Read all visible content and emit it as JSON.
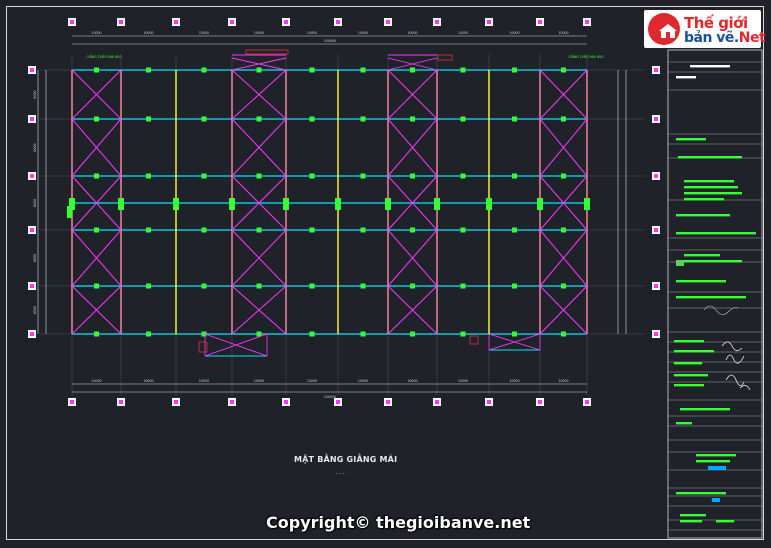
{
  "drawing": {
    "title": "MẶT BẰNG GIẰNG MÁI",
    "scale_note": "- - -",
    "bay_dims_top": [
      "10000",
      "10000",
      "10000",
      "10000",
      "10000",
      "10000",
      "10000",
      "10000",
      "10000",
      "10000"
    ],
    "overall_dim": "100000",
    "left_dims": [
      "6000",
      "6000",
      "6000",
      "6000",
      "6000"
    ],
    "total_left": "36000",
    "note_left": "GIẰNG CHÉO MÁI Φ20",
    "note_right": "GIẰNG CHÉO MÁI Φ20",
    "colors": {
      "background": "#1f2329",
      "rafter": "#ffff33",
      "purlin": "#00e5ff",
      "bracing": "#ff33ff",
      "strut": "#33ff33",
      "dimension": "#d8d8d8",
      "marker": "#ff33ff"
    }
  },
  "logo": {
    "line1": "Thế giới",
    "line2": "bản vẽ.",
    "line2_accent": "Net",
    "icon": "house-icon"
  },
  "title_block": {
    "rows_count": 30
  },
  "watermark": {
    "text": "Copyright© thegioibanve.net"
  }
}
